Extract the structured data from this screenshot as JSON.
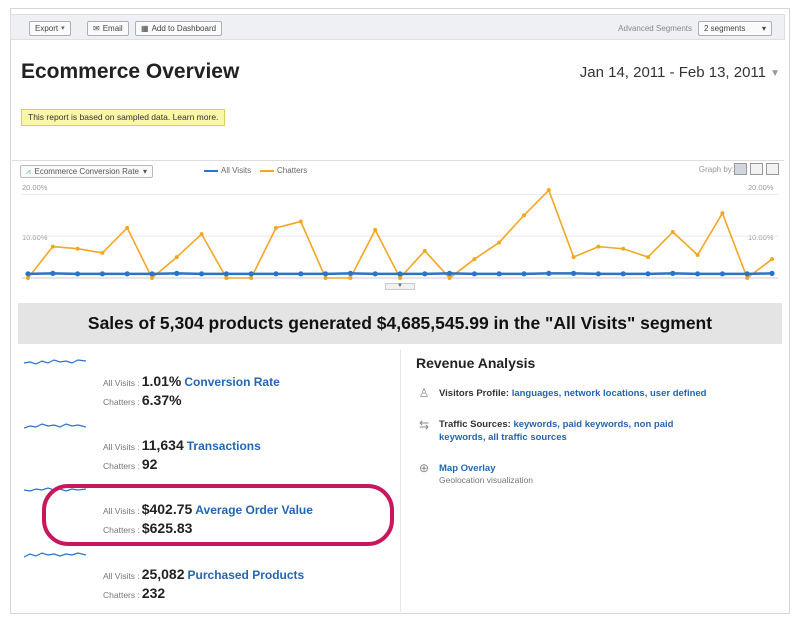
{
  "toolbar": {
    "export_label": "Export",
    "email_label": "Email",
    "dashboard_label": "Add to Dashboard",
    "advanced_segments_label": "Advanced Segments",
    "segments_value": "2 segments"
  },
  "header": {
    "title": "Ecommerce Overview",
    "date_range": "Jan 14, 2011 - Feb 13, 2011"
  },
  "notice": "This report is based on sampled data. Learn more.",
  "graph": {
    "metric": "Ecommerce Conversion Rate",
    "series_labels": [
      "All Visits",
      "Chatters"
    ],
    "graph_by_label": "Graph by:",
    "ytick_top": "20.00%",
    "ytick_mid": "10.00%",
    "ytick_top_right": "20.00%",
    "ytick_mid_right": "10.00%"
  },
  "chart_data": {
    "type": "line",
    "x": [
      1,
      2,
      3,
      4,
      5,
      6,
      7,
      8,
      9,
      10,
      11,
      12,
      13,
      14,
      15,
      16,
      17,
      18,
      19,
      20,
      21,
      22,
      23,
      24,
      25,
      26,
      27,
      28,
      29,
      30,
      31
    ],
    "series": [
      {
        "name": "All Visits",
        "color": "#2a74c8",
        "values": [
          1.0,
          1.1,
          1.0,
          1.0,
          1.0,
          1.0,
          1.1,
          1.0,
          1.0,
          1.0,
          1.0,
          1.0,
          1.0,
          1.1,
          1.0,
          1.0,
          1.0,
          1.1,
          1.0,
          1.0,
          1.0,
          1.1,
          1.1,
          1.0,
          1.0,
          1.0,
          1.1,
          1.0,
          1.0,
          1.0,
          1.1
        ]
      },
      {
        "name": "Chatters",
        "color": "#f5a623",
        "values": [
          0.0,
          7.5,
          7.0,
          6.0,
          12.0,
          0.0,
          5.0,
          10.5,
          0.0,
          0.0,
          12.0,
          13.5,
          0.0,
          0.0,
          11.5,
          0.0,
          6.5,
          0.0,
          4.5,
          8.5,
          15.0,
          21.0,
          5.0,
          7.5,
          7.0,
          5.0,
          11.0,
          5.5,
          15.5,
          0.0,
          4.5
        ]
      }
    ],
    "ylim": [
      0,
      22
    ]
  },
  "banner": "Sales of 5,304 products generated $4,685,545.99 in the \"All Visits\" segment",
  "stats": [
    {
      "all_label": "All Visits :",
      "all_value": "1.01%",
      "metric": "Conversion Rate",
      "chat_label": "Chatters :",
      "chat_value": "6.37%"
    },
    {
      "all_label": "All Visits :",
      "all_value": "11,634",
      "metric": "Transactions",
      "chat_label": "Chatters :",
      "chat_value": "92"
    },
    {
      "all_label": "All Visits :",
      "all_value": "$402.75",
      "metric": "Average Order Value",
      "chat_label": "Chatters :",
      "chat_value": "$625.83"
    },
    {
      "all_label": "All Visits :",
      "all_value": "25,082",
      "metric": "Purchased Products",
      "chat_label": "Chatters :",
      "chat_value": "232"
    }
  ],
  "revenue": {
    "title": "Revenue Analysis",
    "visitors_label": "Visitors Profile:",
    "visitors_links": [
      "languages,",
      "network locations,",
      "user defined"
    ],
    "traffic_label": "Traffic Sources:",
    "traffic_links_line1": [
      "keywords,",
      "paid keywords,",
      "non paid"
    ],
    "traffic_links_line2": [
      "keywords,",
      "all traffic sources"
    ],
    "map_label": "Map Overlay",
    "map_sub": "Geolocation visualization"
  }
}
